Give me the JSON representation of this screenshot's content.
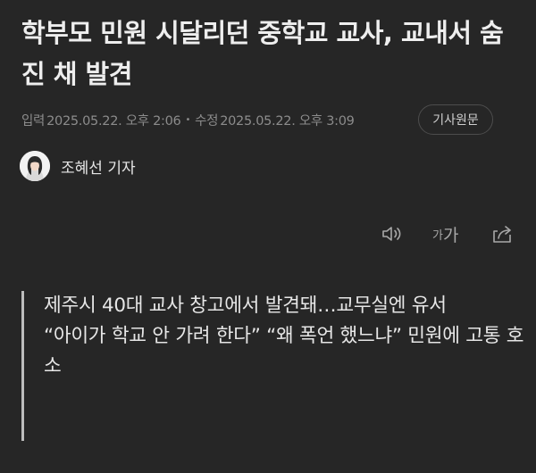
{
  "article": {
    "headline": "학부모 민원 시달리던 중학교 교사, 교내서 숨진 채 발견",
    "meta": {
      "published_label": "입력",
      "published": "2025.05.22. 오후 2:06",
      "updated_label": "수정",
      "updated": "2025.05.22. 오후 3:09",
      "original_button": "기사원문"
    },
    "reporter": {
      "name": "조혜선 기자"
    },
    "toolbar": {
      "audio_icon": "speaker-icon",
      "font_small": "가",
      "font_big": "가",
      "share_icon": "share-icon"
    },
    "summary": [
      "제주시 40대 교사 창고에서 발견돼…교무실엔 유서",
      "“아이가 학교 안 가려 한다” “왜 폭언 했느냐” 민원에 고통 호소"
    ]
  },
  "colors": {
    "background": "#262626",
    "text": "#e6e6e6",
    "muted": "#8c8c8c",
    "quote_bar": "#bdbdbd"
  }
}
